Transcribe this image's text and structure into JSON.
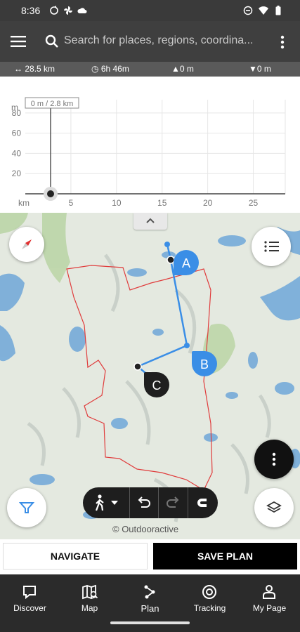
{
  "status_bar": {
    "time": "8:36"
  },
  "search": {
    "placeholder": "Search for places, regions, coordina..."
  },
  "stats": {
    "distance": "28.5 km",
    "duration": "6h 46m",
    "ascent": "0 m",
    "descent": "0 m"
  },
  "chart_data": {
    "type": "line",
    "x": [
      0
    ],
    "y": [
      0
    ],
    "ylabel": "m",
    "xlabel": "km",
    "xlim": [
      0,
      28.5
    ],
    "ylim": [
      0,
      100
    ],
    "x_ticks": [
      "5",
      "10",
      "15",
      "20",
      "25"
    ],
    "y_ticks": [
      "80",
      "60",
      "40",
      "20"
    ],
    "cursor_label": "0 m / 2.8 km",
    "grid": true
  },
  "map": {
    "copyright": "© Outdooractive",
    "waypoints": [
      {
        "label": "A",
        "color": "#3a8ee6"
      },
      {
        "label": "B",
        "color": "#3a8ee6"
      },
      {
        "label": "C",
        "color": "#1f1f1f"
      }
    ]
  },
  "buttons": {
    "navigate": "NAVIGATE",
    "save": "SAVE PLAN"
  },
  "tabs": [
    {
      "label": "Discover",
      "icon": "discover-icon"
    },
    {
      "label": "Map",
      "icon": "map-icon"
    },
    {
      "label": "Plan",
      "icon": "plan-icon"
    },
    {
      "label": "Tracking",
      "icon": "tracking-icon"
    },
    {
      "label": "My Page",
      "icon": "person-icon"
    }
  ],
  "colors": {
    "route": "#3a8ee6",
    "region_border": "#e03c3c",
    "status_bar": "#3a3a3a",
    "app_bar": "#3f3f3f"
  }
}
